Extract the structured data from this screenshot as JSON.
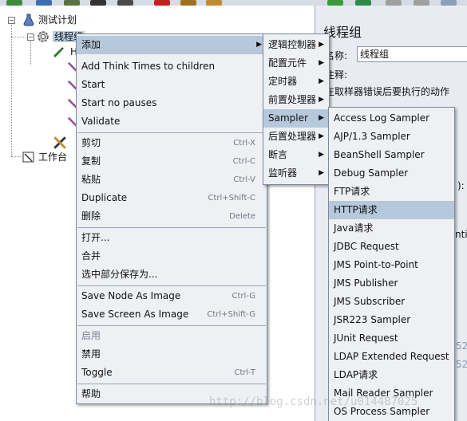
{
  "tree": {
    "test_plan": "测试计划",
    "thread_group": "线程组",
    "item_h": "H",
    "workbench": "工作台"
  },
  "right_panel": {
    "title": "线程组",
    "name_label": "名称:",
    "name_value": "线程组",
    "comment_label": "注释:",
    "error_action_label": "在取样器错误后要执行的动作",
    "frag_paren": "):",
    "frag_ntil": "ntil",
    "frag_52a": "52",
    "frag_52b": "52"
  },
  "context_menu": {
    "items": [
      {
        "label": "添加",
        "submenu": true,
        "highlighted": true
      },
      {
        "label": "Add Think Times to children"
      },
      {
        "label": "Start"
      },
      {
        "label": "Start no pauses"
      },
      {
        "label": "Validate"
      },
      {
        "label": "剪切",
        "shortcut": "Ctrl-X"
      },
      {
        "label": "复制",
        "shortcut": "Ctrl-C"
      },
      {
        "label": "粘贴",
        "shortcut": "Ctrl-V"
      },
      {
        "label": "Duplicate",
        "shortcut": "Ctrl+Shift-C"
      },
      {
        "label": "删除",
        "shortcut": "Delete"
      },
      {
        "label": "打开..."
      },
      {
        "label": "合并"
      },
      {
        "label": "选中部分保存为..."
      },
      {
        "label": "Save Node As Image",
        "shortcut": "Ctrl-G"
      },
      {
        "label": "Save Screen As Image",
        "shortcut": "Ctrl+Shift-G"
      },
      {
        "label": "启用",
        "disabled": true
      },
      {
        "label": "禁用"
      },
      {
        "label": "Toggle",
        "shortcut": "Ctrl-T"
      },
      {
        "label": "帮助"
      }
    ]
  },
  "add_submenu": {
    "items": [
      {
        "label": "逻辑控制器"
      },
      {
        "label": "配置元件"
      },
      {
        "label": "定时器"
      },
      {
        "label": "前置处理器"
      },
      {
        "label": "Sampler",
        "highlighted": true
      },
      {
        "label": "后置处理器"
      },
      {
        "label": "断言"
      },
      {
        "label": "监听器"
      }
    ]
  },
  "sampler_submenu": {
    "items": [
      {
        "label": "Access Log Sampler"
      },
      {
        "label": "AJP/1.3 Sampler"
      },
      {
        "label": "BeanShell Sampler"
      },
      {
        "label": "Debug Sampler"
      },
      {
        "label": "FTP请求"
      },
      {
        "label": "HTTP请求",
        "highlighted": true
      },
      {
        "label": "Java请求"
      },
      {
        "label": "JDBC Request"
      },
      {
        "label": "JMS Point-to-Point"
      },
      {
        "label": "JMS Publisher"
      },
      {
        "label": "JMS Subscriber"
      },
      {
        "label": "JSR223 Sampler"
      },
      {
        "label": "JUnit Request"
      },
      {
        "label": "LDAP Extended Request"
      },
      {
        "label": "LDAP请求"
      },
      {
        "label": "Mail Reader Sampler"
      },
      {
        "label": "OS Process Sampler"
      }
    ]
  },
  "watermark": "http://blog.csdn.net/u014487025",
  "colors": {
    "highlight": "#b6c9dc",
    "menu_bg": "#eef0f4",
    "panel_bg": "#e8ecf2"
  }
}
